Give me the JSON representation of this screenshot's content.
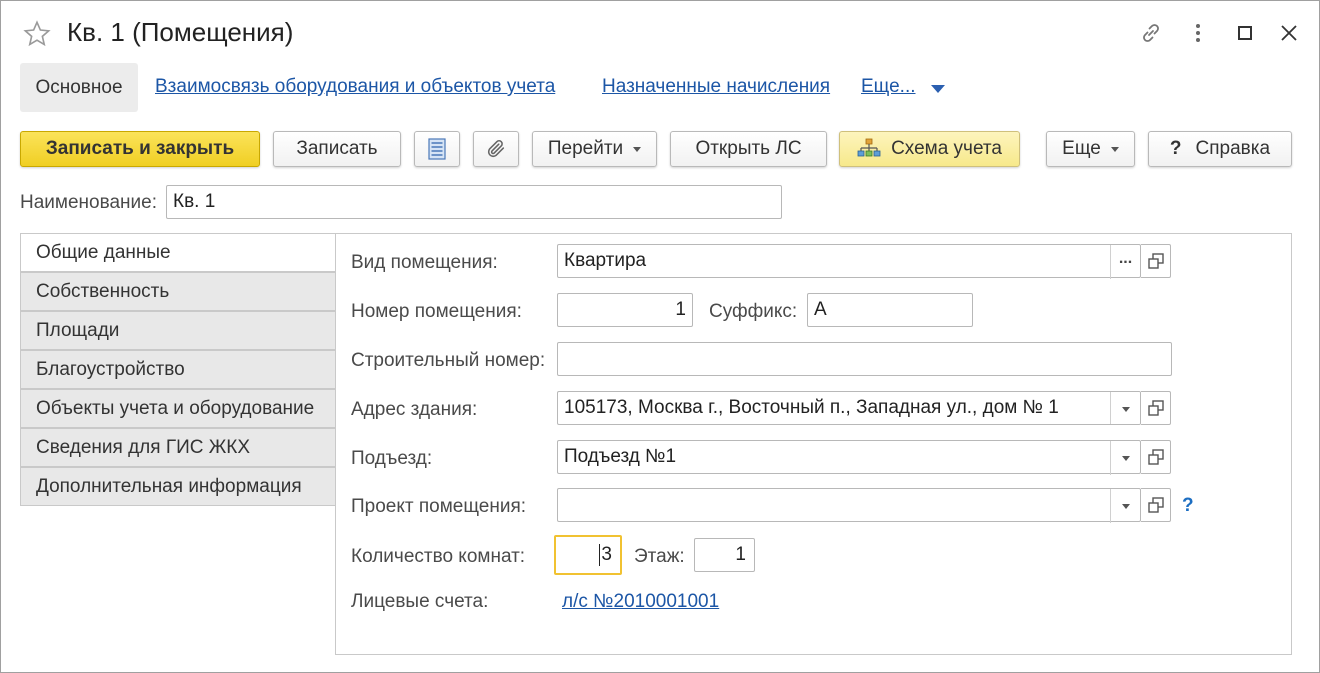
{
  "window": {
    "title": "Кв. 1 (Помещения)"
  },
  "nav": {
    "active_tab": "Основное",
    "links": [
      "Взаимосвязь оборудования и объектов учета",
      "Назначенные начисления",
      "Еще..."
    ]
  },
  "toolbar": {
    "save_close": "Записать и закрыть",
    "save": "Записать",
    "goto": "Перейти",
    "open_ls": "Открыть ЛС",
    "scheme": "Схема учета",
    "more": "Еще",
    "help": "Справка",
    "help_glyph": "?"
  },
  "name_field": {
    "label": "Наименование:",
    "value": "Кв. 1"
  },
  "side_tabs": [
    "Общие данные",
    "Собственность",
    "Площади",
    "Благоустройство",
    "Объекты учета и оборудование",
    "Сведения для ГИС ЖКХ",
    "Дополнительная информация"
  ],
  "form": {
    "room_type": {
      "label": "Вид помещения:",
      "value": "Квартира",
      "select_glyph": "..."
    },
    "room_number": {
      "label": "Номер помещения:",
      "value": "1"
    },
    "suffix": {
      "label": "Суффикс:",
      "value": "А"
    },
    "build_number": {
      "label": "Строительный номер:",
      "value": ""
    },
    "address": {
      "label": "Адрес здания:",
      "value": "105173, Москва г., Восточный п., Западная ул., дом № 1"
    },
    "entrance": {
      "label": "Подъезд:",
      "value": "Подъезд №1"
    },
    "project": {
      "label": "Проект помещения:",
      "value": "",
      "help": "?"
    },
    "rooms_count": {
      "label": "Количество комнат:",
      "value": "3"
    },
    "floor": {
      "label": "Этаж:",
      "value": "1"
    },
    "accounts": {
      "label": "Лицевые счета:",
      "value": "л/с №2010001001"
    }
  },
  "colors": {
    "primary_button": "#f0cf23",
    "link": "#1c56a6",
    "focus_border": "#f1c231"
  }
}
